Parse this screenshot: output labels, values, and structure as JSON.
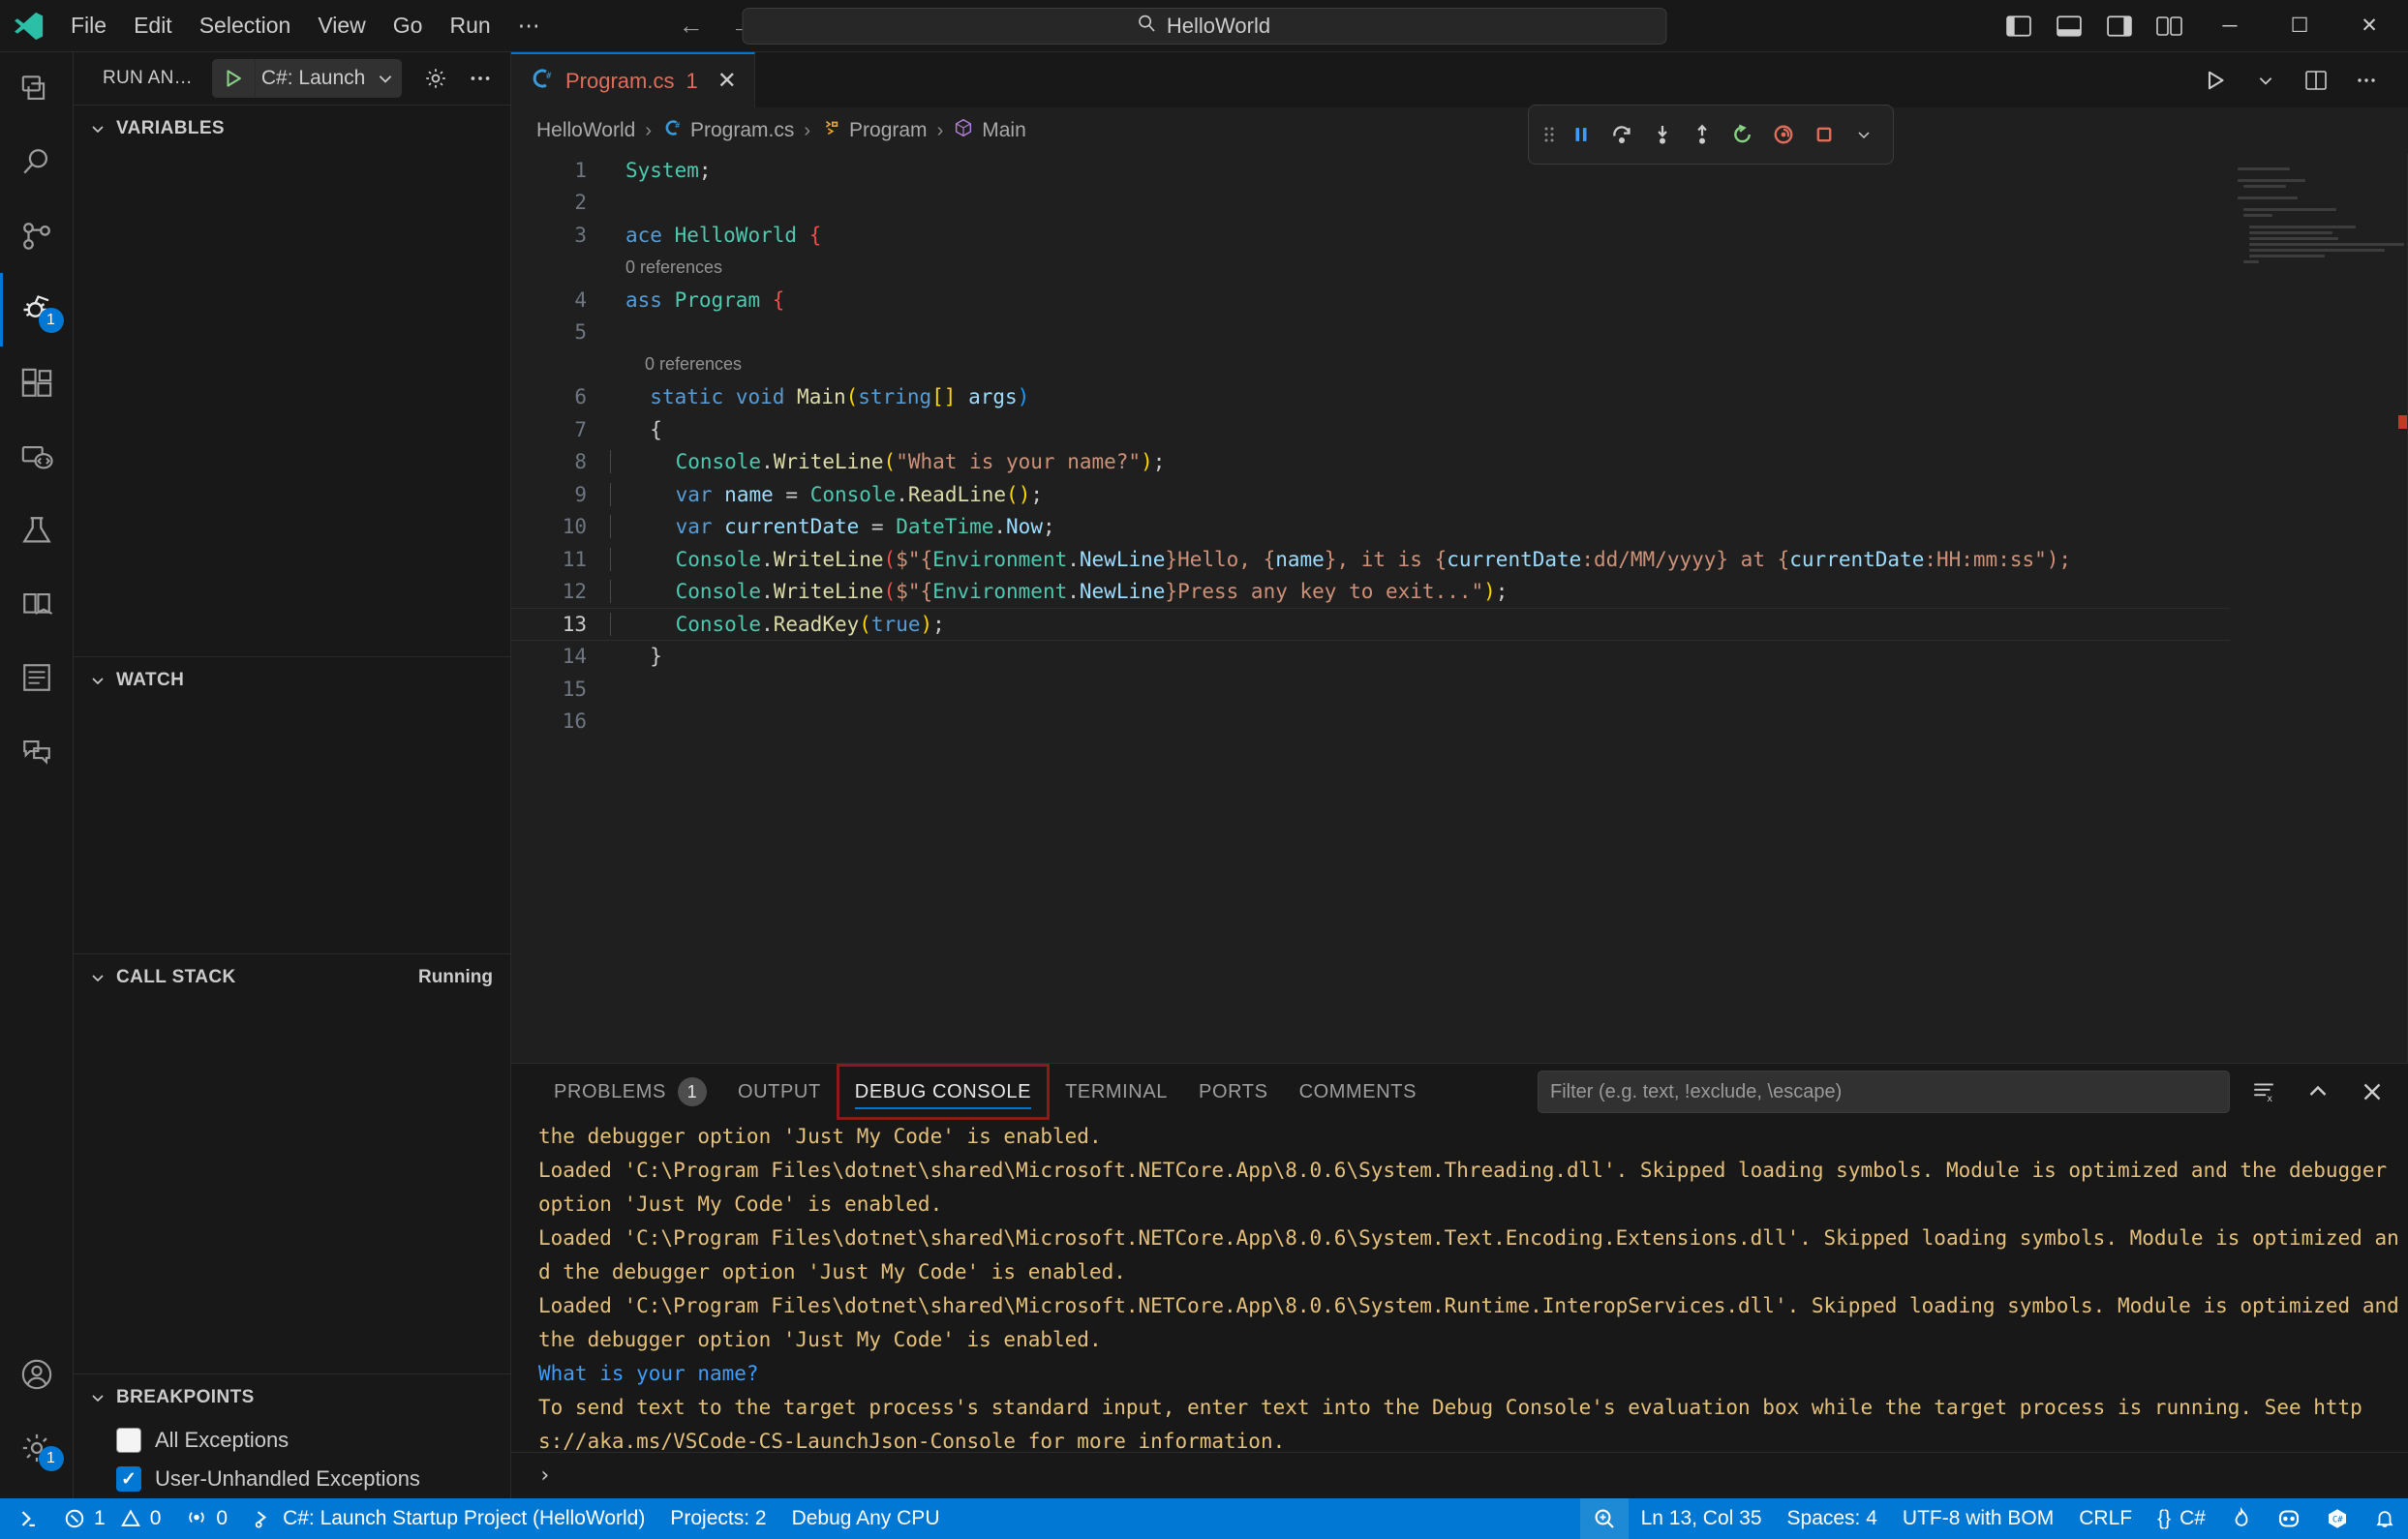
{
  "titlebar": {
    "menu": [
      "File",
      "Edit",
      "Selection",
      "View",
      "Go",
      "Run",
      "⋯"
    ],
    "search_text": "HelloWorld",
    "search_icon": "search-icon",
    "back_icon": "←",
    "forward_icon": "→",
    "minimize": "─",
    "maximize": "☐",
    "close": "✕"
  },
  "activitybar": {
    "items": [
      {
        "name": "explorer",
        "badge": ""
      },
      {
        "name": "search",
        "badge": ""
      },
      {
        "name": "source-control",
        "badge": ""
      },
      {
        "name": "run-and-debug",
        "badge": "1"
      },
      {
        "name": "extensions",
        "badge": ""
      },
      {
        "name": "remote-explorer",
        "badge": ""
      },
      {
        "name": "testing",
        "badge": ""
      },
      {
        "name": "learn",
        "badge": ""
      },
      {
        "name": "solution-explorer",
        "badge": ""
      },
      {
        "name": "chat",
        "badge": ""
      }
    ],
    "bottom": [
      {
        "name": "accounts",
        "badge": ""
      },
      {
        "name": "settings",
        "badge": "1"
      }
    ]
  },
  "sidebar": {
    "title": "RUN AN…",
    "launch_config": "C#: Launch",
    "sections": [
      {
        "id": "variables",
        "title": "VARIABLES",
        "extra": ""
      },
      {
        "id": "watch",
        "title": "WATCH",
        "extra": ""
      },
      {
        "id": "callstack",
        "title": "CALL STACK",
        "extra": "Running"
      },
      {
        "id": "breakpoints",
        "title": "BREAKPOINTS",
        "extra": ""
      }
    ],
    "breakpoints": [
      {
        "label": "All Exceptions",
        "checked": false
      },
      {
        "label": "User-Unhandled Exceptions",
        "checked": true
      }
    ]
  },
  "editor": {
    "tab": {
      "label": "Program.cs",
      "count": "1",
      "close": "✕",
      "icon": "csharp-icon"
    },
    "breadcrumb": [
      {
        "label": "HelloWorld",
        "icon": ""
      },
      {
        "label": "Program.cs",
        "icon": "csharp-icon"
      },
      {
        "label": "Program",
        "icon": "class-icon"
      },
      {
        "label": "Main",
        "icon": "method-icon"
      }
    ],
    "debug_toolbar": [
      {
        "name": "drag-handle",
        "title": ""
      },
      {
        "name": "pause-button",
        "title": "Pause"
      },
      {
        "name": "step-over-button",
        "title": "Step Over"
      },
      {
        "name": "step-into-button",
        "title": "Step Into"
      },
      {
        "name": "step-out-button",
        "title": "Step Out"
      },
      {
        "name": "restart-button",
        "title": "Restart"
      },
      {
        "name": "hot-reload-button",
        "title": "Hot Reload"
      },
      {
        "name": "stop-button",
        "title": "Stop"
      },
      {
        "name": "stop-dropdown",
        "title": ""
      }
    ],
    "actions": [
      {
        "name": "run-button"
      },
      {
        "name": "run-dropdown"
      },
      {
        "name": "split-editor-button"
      },
      {
        "name": "more-actions-button"
      }
    ],
    "codelens_1": "0 references",
    "codelens_2": "0 references",
    "lines": [
      {
        "n": "1",
        "text": "System;"
      },
      {
        "n": "2",
        "text": ""
      },
      {
        "n": "3",
        "text": "ace HelloWorld {"
      },
      {
        "n": "4",
        "text": "ass Program {"
      },
      {
        "n": "5",
        "text": ""
      },
      {
        "n": "6",
        "text": "  static void Main(string[] args)"
      },
      {
        "n": "7",
        "text": "  {"
      },
      {
        "n": "8",
        "text": "      Console.WriteLine(\"What is your name?\");"
      },
      {
        "n": "9",
        "text": "      var name = Console.ReadLine();"
      },
      {
        "n": "10",
        "text": "      var currentDate = DateTime.Now;"
      },
      {
        "n": "11",
        "text": "      Console.WriteLine($\"{Environment.NewLine}Hello, {name}, it is {currentDate:dd/MM/yyyy} at {currentDate:HH:mm:ss\");"
      },
      {
        "n": "12",
        "text": "      Console.WriteLine($\"{Environment.NewLine}Press any key to exit...\");"
      },
      {
        "n": "13",
        "text": "      Console.ReadKey(true);"
      },
      {
        "n": "14",
        "text": "  }"
      },
      {
        "n": "15",
        "text": ""
      },
      {
        "n": "16",
        "text": ""
      }
    ]
  },
  "panel": {
    "tabs": [
      {
        "label": "PROBLEMS",
        "badge": "1",
        "active": false,
        "highlight": false
      },
      {
        "label": "OUTPUT",
        "badge": "",
        "active": false,
        "highlight": false
      },
      {
        "label": "DEBUG CONSOLE",
        "badge": "",
        "active": true,
        "highlight": true
      },
      {
        "label": "TERMINAL",
        "badge": "",
        "active": false,
        "highlight": false
      },
      {
        "label": "PORTS",
        "badge": "",
        "active": false,
        "highlight": false
      },
      {
        "label": "COMMENTS",
        "badge": "",
        "active": false,
        "highlight": false
      }
    ],
    "filter_placeholder": "Filter (e.g. text, !exclude, \\escape)",
    "filter_value": "",
    "icons": [
      {
        "name": "clear-console-icon"
      },
      {
        "name": "chevron-up-icon"
      },
      {
        "name": "close-panel-icon"
      }
    ],
    "console_lines": [
      {
        "text": "the debugger option 'Just My Code' is enabled.",
        "kind": "log"
      },
      {
        "text": "Loaded 'C:\\Program Files\\dotnet\\shared\\Microsoft.NETCore.App\\8.0.6\\System.Threading.dll'. Skipped loading symbols. Module is optimized and the debugger option 'Just My Code' is enabled.",
        "kind": "log"
      },
      {
        "text": "Loaded 'C:\\Program Files\\dotnet\\shared\\Microsoft.NETCore.App\\8.0.6\\System.Text.Encoding.Extensions.dll'. Skipped loading symbols. Module is optimized and the debugger option 'Just My Code' is enabled.",
        "kind": "log"
      },
      {
        "text": "Loaded 'C:\\Program Files\\dotnet\\shared\\Microsoft.NETCore.App\\8.0.6\\System.Runtime.InteropServices.dll'. Skipped loading symbols. Module is optimized and the debugger option 'Just My Code' is enabled.",
        "kind": "log"
      },
      {
        "text": "What is your name?",
        "kind": "output"
      },
      {
        "text": "To send text to the target process's standard input, enter text into the Debug Console's evaluation box while the target process is running. See https://aka.ms/VSCode-CS-LaunchJson-Console for more information.",
        "kind": "log"
      }
    ],
    "input_prompt": "›"
  },
  "statusbar": {
    "left": [
      {
        "name": "remote-indicator",
        "label": ""
      },
      {
        "name": "errors",
        "label": "1"
      },
      {
        "name": "warnings",
        "label": "0"
      },
      {
        "name": "radio-tower",
        "label": "0"
      },
      {
        "name": "launch-target",
        "label": "C#: Launch Startup Project (HelloWorld)"
      },
      {
        "name": "projects",
        "label": "Projects: 2"
      },
      {
        "name": "build-config",
        "label": "Debug Any CPU"
      }
    ],
    "right": [
      {
        "name": "screencast-zoom",
        "label": ""
      },
      {
        "name": "cursor-position",
        "label": "Ln 13, Col 35"
      },
      {
        "name": "indentation",
        "label": "Spaces: 4"
      },
      {
        "name": "encoding",
        "label": "UTF-8 with BOM"
      },
      {
        "name": "eol",
        "label": "CRLF"
      },
      {
        "name": "language-mode",
        "label": "C#"
      },
      {
        "name": "flame-icon",
        "label": ""
      },
      {
        "name": "intellicode-icon",
        "label": ""
      },
      {
        "name": "csharp-icon",
        "label": ""
      },
      {
        "name": "notifications",
        "label": ""
      }
    ]
  },
  "colors": {
    "accent": "#0078d4",
    "bg": "#1f1f1f",
    "bg_dark": "#181818",
    "console_log": "#e5c07b",
    "console_out": "#3b9eff",
    "error_red": "#f14c4c",
    "highlight_box": "#8b1a1a"
  }
}
